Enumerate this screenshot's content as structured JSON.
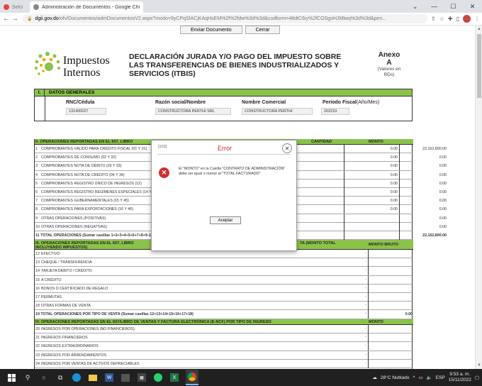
{
  "browser": {
    "tabs": [
      {
        "label": "Selci",
        "icon": "gmail-icon"
      },
      {
        "label": "Administración de Documentos - Google Chrome",
        "icon": "dgii-icon"
      }
    ],
    "url_host": "dgii.gov.do",
    "url_rest": "/ofv/Documentos/admDocumentosV2.aspx?modo=9yCPqSfACjKAqHsEM%2f%2fdw%3d%3d&codform=48dtC6iy%2fCOSgoHJMlwq%3d%3d&peri..."
  },
  "toolbar": {
    "send_label": "Enviar Documento",
    "close_label": "Cerrar"
  },
  "logo": {
    "line1": "Impuestos",
    "line2": "Internos"
  },
  "heading": "DECLARACIÓN JURADA Y/O PAGO DEL IMPUESTO SOBRE LAS TRANSFERENCIAS DE BIENES INDUSTRIALIZADOS Y SERVICIOS (ITBIS)",
  "anexo": {
    "line1": "Anexo",
    "line2": "A",
    "line3": "(Valores en RDs)"
  },
  "general": {
    "section": "I.",
    "title": "DATOS GENERALES",
    "rnc_label": "RNC/Cédula",
    "rnc_value": "131400027",
    "razon_label": "Razón social/Nombre",
    "razon_value": "CONSTRUCTORA PERTHI SRL",
    "comercial_label": "Nombre Comercial",
    "comercial_value": "CONSTRUCTORA PERTHI",
    "periodo_label": "Período Fiscal",
    "periodo_suffix": "(Año/Mes)",
    "periodo_value": "202210"
  },
  "section2": {
    "title": "II. OPERACIONES REPORTADAS EN EL 607, LIBRO",
    "col_cantidad": "CANTIDAD",
    "col_monto": "MONTO",
    "rows": [
      {
        "num": "1",
        "label": "COMPROBANTES VÁLIDO PARA CRÉDITO FISCAL (01 Y 31)",
        "qty": "0.00",
        "amount": "22,162,800.00"
      },
      {
        "num": "2",
        "label": "COMPROBANTES DE CONSUMO (02 Y 32)",
        "qty": "0.00",
        "amount": "0.00"
      },
      {
        "num": "3",
        "label": "COMPROBANTES NOTA DE DÉBITO (03 Y 33)",
        "qty": "0.00",
        "amount": "0.00"
      },
      {
        "num": "4",
        "label": "COMPROBANTES NOTA DE CRÉDITO (04 Y 34)",
        "qty": "0.00",
        "amount": "0.00"
      },
      {
        "num": "5",
        "label": "COMPROBANTES REGISTRO ÚNICO DE INGRESOS (12)",
        "qty": "0.00",
        "amount": "0.00"
      },
      {
        "num": "6",
        "label": "COMPROBANTES REGISTRO REGÍMENES ESPECIALES (14 Y 44)",
        "qty": "0.00",
        "amount": "0.00"
      },
      {
        "num": "7",
        "label": "COMPROBANTES GUBERNAMENTALES (15 Y 45)",
        "qty": "0.00",
        "amount": "0.00"
      },
      {
        "num": "8",
        "label": "COMPROBANTES PARA EXPORTACIONES (16 Y 46)",
        "qty": "0.00",
        "amount": "0.00"
      },
      {
        "num": "9",
        "label": "OTRAS OPERACIONES (POSITIVAS)",
        "qty": "",
        "amount": "0.00"
      },
      {
        "num": "10",
        "label": "OTRAS OPERACIONES (NEGATIVAS)",
        "qty": "",
        "amount": "0.00"
      }
    ],
    "total": {
      "label": "11 TOTAL OPERACIONES (Sumar casillas 1+2+3+4+5+6+7+8+9-10)",
      "amount": "22,162,800.00"
    }
  },
  "section3": {
    "title": "III. OPERACIONES REPORTADAS EN EL 607, LIBRO DE VENTAS Y FACTURA ELECTRÓNICA (E-NCF) POR TIPO DE VENTA (MONTO TOTAL INCLUYENDO IMPUESTOS)",
    "title_tail": "TA (MONTO TOTAL",
    "title_line2": "INCLUYENDO IMPUESTOS)",
    "col": "MONTO BRUTO",
    "rows": [
      {
        "num": "12",
        "label": "EFECTIVO"
      },
      {
        "num": "13",
        "label": "CHEQUE / TRANSFERENCIA"
      },
      {
        "num": "14",
        "label": "TARJETA DÉBITO / CRÉDITO"
      },
      {
        "num": "15",
        "label": "A CRÉDITO"
      },
      {
        "num": "16",
        "label": "BONOS O CERTIFICADO DE REGALO"
      },
      {
        "num": "17",
        "label": "PERMUTAS"
      },
      {
        "num": "18",
        "label": "OTRAS FORMAS DE VENTA"
      }
    ],
    "total": {
      "label": "19 TOTAL OPERACIONES POR TIPO DE VENTA (Sumar casillas 12+13+14+15+16+17+18)",
      "amount": "0.00"
    }
  },
  "section4": {
    "title": "IV. OPERACIONES REPORTADAS EN EL 607/LIBRO DE VENTAS Y FACTURA ELECTRÓNICA (E-NCF) POR TIPO DE INGRESO",
    "col": "MONTO",
    "rows": [
      {
        "num": "20",
        "label": "INGRESOS POR OPERACIONES (NO FINANCIEROS)"
      },
      {
        "num": "21",
        "label": "INGRESOS FINANCIEROS"
      },
      {
        "num": "22",
        "label": "INGRESOS EXTRAORDINARIOS"
      },
      {
        "num": "23",
        "label": "INGRESOS POR ARRENDAMIENTOS"
      },
      {
        "num": "24",
        "label": "INGRESOS POR VENTAS DE ACTIVOS DEPRECIABLES"
      }
    ]
  },
  "dialog": {
    "code": "[103]",
    "title": "Error",
    "message": "El \"MONTO\" en la Casilla \"CONTRATO DE ADMINISTRACIÓN\" debe ser igual o menor al \"TOTAL FACTURADO\".",
    "ok_label": "Aceptar"
  },
  "taskbar": {
    "weather": "28°C Nublado",
    "lang": "ESP",
    "time": "9:53 a. m.",
    "date": "15/11/2022"
  },
  "colors": {
    "section_green": "#8bc34a",
    "error_red": "#d32f2f"
  }
}
